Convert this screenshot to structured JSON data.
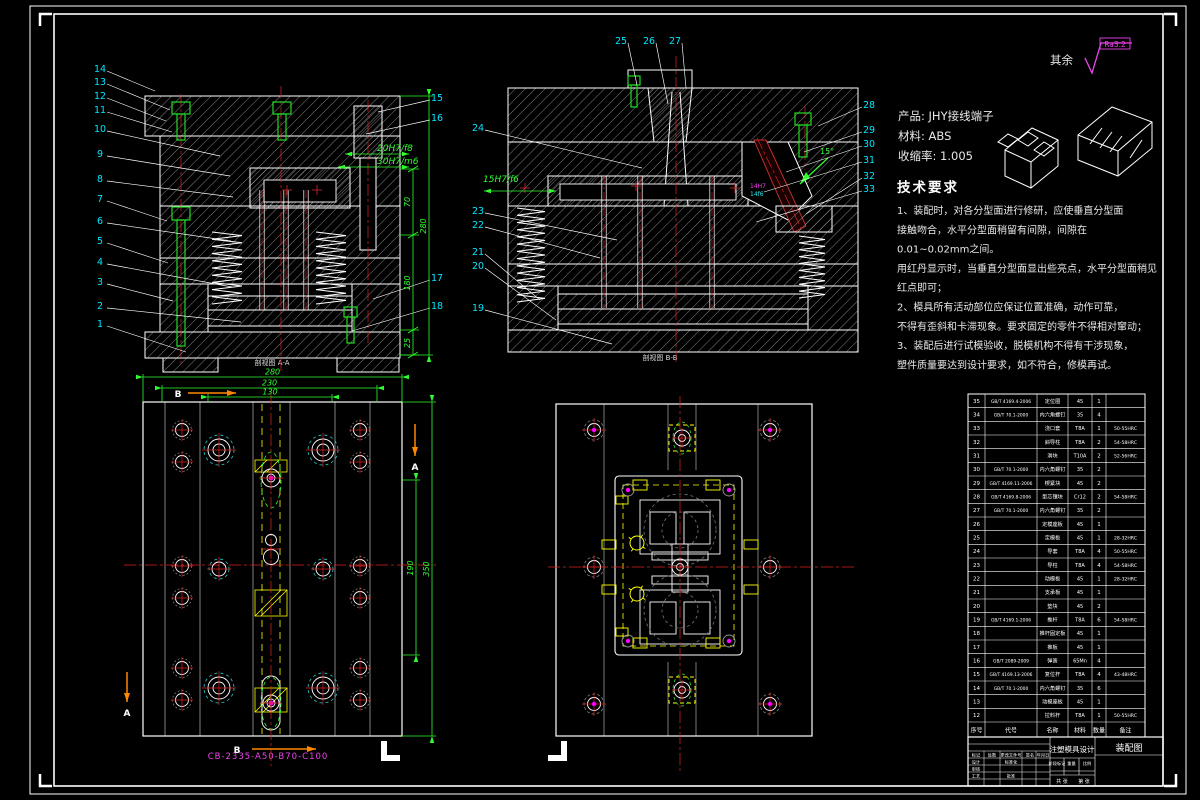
{
  "colors": {
    "balloon": "#00e5ff",
    "dimension": "#2eff2e",
    "centerline": "#dd2222",
    "highlight": "#ff00ff",
    "aux": "#ffff00",
    "section_arrow": "#ff8800"
  },
  "roughness": {
    "prefix": "其余",
    "value": "Ra3.2"
  },
  "product": {
    "line1": "产品: JHY接线端子",
    "line2": "材料: ABS",
    "line3": "收缩率: 1.005"
  },
  "tech": {
    "title": "技术要求",
    "lines": [
      "1、装配时，对各分型面进行修研，应使垂直分型面",
      "接触吻合，水平分型面稍留有间隙，间隙在",
      "0.01~0.02mm之间。",
      "用红丹显示时，当垂直分型面显出些亮点，水平分型面稍见",
      "红点即可；",
      "2、模具所有活动部位应保证位置准确，动作可靠，",
      "不得有歪斜和卡滞现象。要求固定的零件不得相对窜动；",
      "3、装配后进行试模验收，脱模机构不得有干涉现象，",
      "塑件质量要达到设计要求，如不符合，修模再试。"
    ]
  },
  "section_aa": {
    "caption": "剖视图 A-A",
    "balloons_left": [
      "14",
      "13",
      "12",
      "11",
      "10",
      "9",
      "8",
      "7",
      "6",
      "5",
      "4",
      "3",
      "2",
      "1"
    ],
    "balloons_right": [
      "15",
      "16",
      "17",
      "18"
    ],
    "fit1": "20H7/f8",
    "fit2": "30H7/m6",
    "vdims": [
      "70",
      "180",
      "25"
    ],
    "vtotal": "280"
  },
  "section_bb": {
    "caption": "剖视图 B-B",
    "balloons_left": [
      "24",
      "23",
      "22",
      "21",
      "20",
      "19"
    ],
    "balloons_top": [
      "25",
      "26",
      "27"
    ],
    "balloons_right": [
      "28",
      "29",
      "30",
      "31",
      "32",
      "33"
    ],
    "fit": "15H7/f6",
    "angle": "15°",
    "slide_fit_a": "14H7",
    "slide_fit_b": "14f6"
  },
  "plan_fixed": {
    "dims_top": [
      "280",
      "230",
      "130"
    ],
    "dim_right_outer": "350",
    "dim_right_inner": "190",
    "section_letters": [
      "B",
      "A",
      "A",
      "B"
    ],
    "mold_base_code": "CB-2335-A50-B70-C100"
  },
  "bom": {
    "headers": [
      "序号",
      "代号",
      "名称",
      "材料",
      "数量",
      "备注"
    ],
    "rows": [
      [
        "35",
        "GB/T 4169.4-2006",
        "定位圈",
        "45",
        "1",
        ""
      ],
      [
        "34",
        "GB/T 70.1-2000",
        "内六角螺钉",
        "35",
        "4",
        ""
      ],
      [
        "33",
        "",
        "浇口套",
        "T8A",
        "1",
        "50-55HRC"
      ],
      [
        "32",
        "",
        "斜导柱",
        "T8A",
        "2",
        "54-58HRC"
      ],
      [
        "31",
        "",
        "滑块",
        "T10A",
        "2",
        "52-56HRC"
      ],
      [
        "30",
        "GB/T 70.1-2000",
        "内六角螺钉",
        "35",
        "2",
        ""
      ],
      [
        "29",
        "GB/T 4169.11-2006",
        "楔紧块",
        "45",
        "2",
        ""
      ],
      [
        "28",
        "GB/T 4169.8-2006",
        "型芯镶块",
        "Cr12",
        "2",
        "54-58HRC"
      ],
      [
        "27",
        "GB/T 70.1-2000",
        "内六角螺钉",
        "35",
        "2",
        ""
      ],
      [
        "26",
        "",
        "定模座板",
        "45",
        "1",
        ""
      ],
      [
        "25",
        "",
        "定模板",
        "45",
        "1",
        "28-32HRC"
      ],
      [
        "24",
        "",
        "导套",
        "T8A",
        "4",
        "50-55HRC"
      ],
      [
        "23",
        "",
        "导柱",
        "T8A",
        "4",
        "54-58HRC"
      ],
      [
        "22",
        "",
        "动模板",
        "45",
        "1",
        "28-32HRC"
      ],
      [
        "21",
        "",
        "支承板",
        "45",
        "1",
        ""
      ],
      [
        "20",
        "",
        "垫块",
        "45",
        "2",
        ""
      ],
      [
        "19",
        "GB/T 4169.1-2006",
        "推杆",
        "T8A",
        "6",
        "54-58HRC"
      ],
      [
        "18",
        "",
        "推杆固定板",
        "45",
        "1",
        ""
      ],
      [
        "17",
        "",
        "推板",
        "45",
        "1",
        ""
      ],
      [
        "16",
        "GB/T 2089-2009",
        "弹簧",
        "65Mn",
        "4",
        ""
      ],
      [
        "15",
        "GB/T 4169.13-2006",
        "复位杆",
        "T8A",
        "4",
        "43-48HRC"
      ],
      [
        "14",
        "GB/T 70.1-2000",
        "内六角螺钉",
        "35",
        "6",
        ""
      ],
      [
        "13",
        "",
        "动模座板",
        "45",
        "1",
        ""
      ],
      [
        "12",
        "",
        "拉料杆",
        "T8A",
        "1",
        "50-55HRC"
      ]
    ]
  },
  "title_block": {
    "project": "注塑模具设计",
    "drawing_name": "装配图",
    "design": "设计",
    "check": "审核",
    "process": "工艺",
    "standard": "标准化",
    "approve": "批准",
    "mark": "标记",
    "count": "处数",
    "zone": "分区",
    "change_no": "更改文件号",
    "sign": "签名",
    "date": "年月日",
    "stage": "阶段标记",
    "weight": "重量",
    "scale": "比例",
    "sheet_total": "共 张",
    "sheet_no": "第 张"
  }
}
